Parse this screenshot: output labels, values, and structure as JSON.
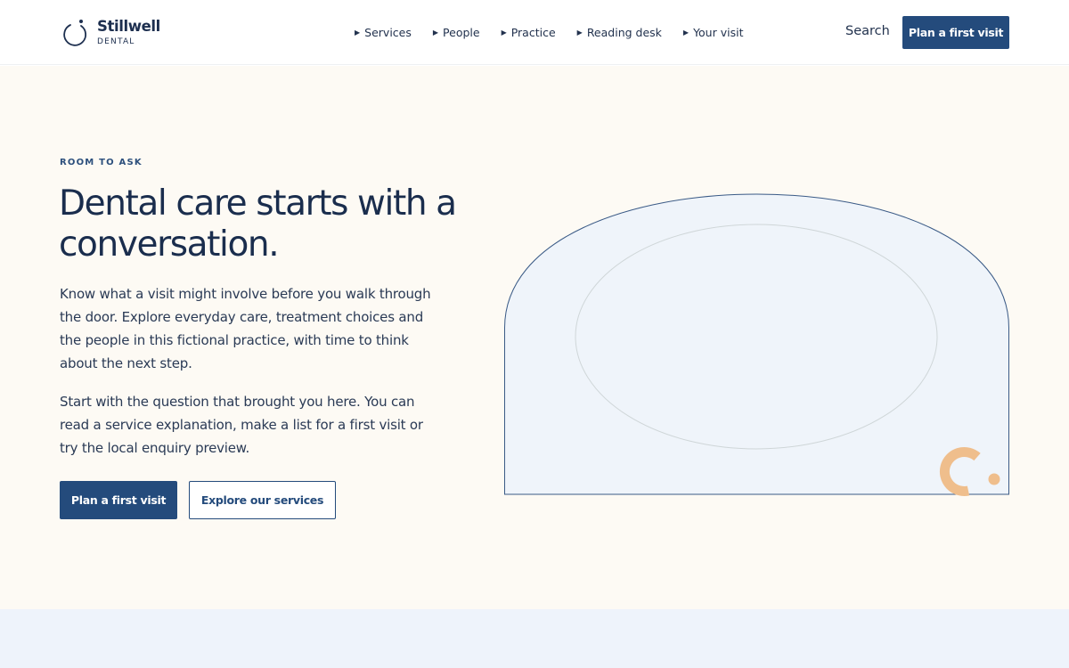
{
  "brand": {
    "name": "Stillwell",
    "subtitle": "DENTAL"
  },
  "nav": {
    "items": [
      {
        "label": "Services"
      },
      {
        "label": "People"
      },
      {
        "label": "Practice"
      },
      {
        "label": "Reading desk"
      },
      {
        "label": "Your visit"
      }
    ],
    "search_label": "Search",
    "cta_label": "Plan a first visit"
  },
  "hero": {
    "eyebrow": "ROOM TO ASK",
    "title": "Dental care starts with a conversation.",
    "paragraphs": [
      "Know what a visit might involve before you walk through the door. Explore everyday care, treatment choices and the people in this fictional practice, with time to think about the next step.",
      "Start with the question that brought you here. You can read a service explanation, make a list for a first visit or try the local enquiry preview."
    ],
    "primary_button": "Plan a first visit",
    "secondary_button": "Explore our services"
  },
  "colors": {
    "navy": "#244b7c",
    "text": "#1a2d4d",
    "hero_bg": "#fdfaf4",
    "illustration_fill": "#eff4fa",
    "accent_peach": "#efbe8c",
    "band_bg": "#eef3fb"
  }
}
